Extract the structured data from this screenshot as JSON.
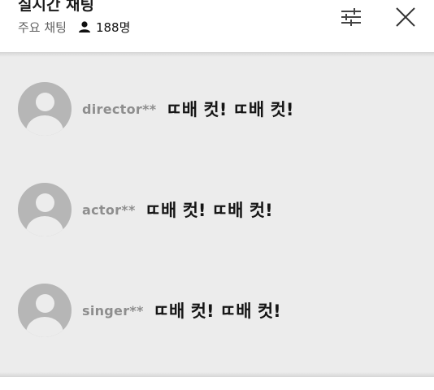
{
  "header": {
    "title": "실시간 채팅",
    "mode_label": "주요 채팅",
    "viewer_count": "188명",
    "filter_icon": "sliders-icon",
    "close_icon": "close-icon"
  },
  "colors": {
    "header_bg": "#ffffff",
    "chat_bg": "#ececec",
    "avatar_bg": "#b6b6b6",
    "author_text": "#8e8e8e",
    "message_text": "#151515"
  },
  "messages": [
    {
      "author": "director**",
      "text": "ㄸ배 컷! ㄸ배 컷!"
    },
    {
      "author": "actor**",
      "text": "ㄸ배 컷! ㄸ배 컷!"
    },
    {
      "author": "singer**",
      "text": "ㄸ배 컷! ㄸ배 컷!"
    }
  ]
}
